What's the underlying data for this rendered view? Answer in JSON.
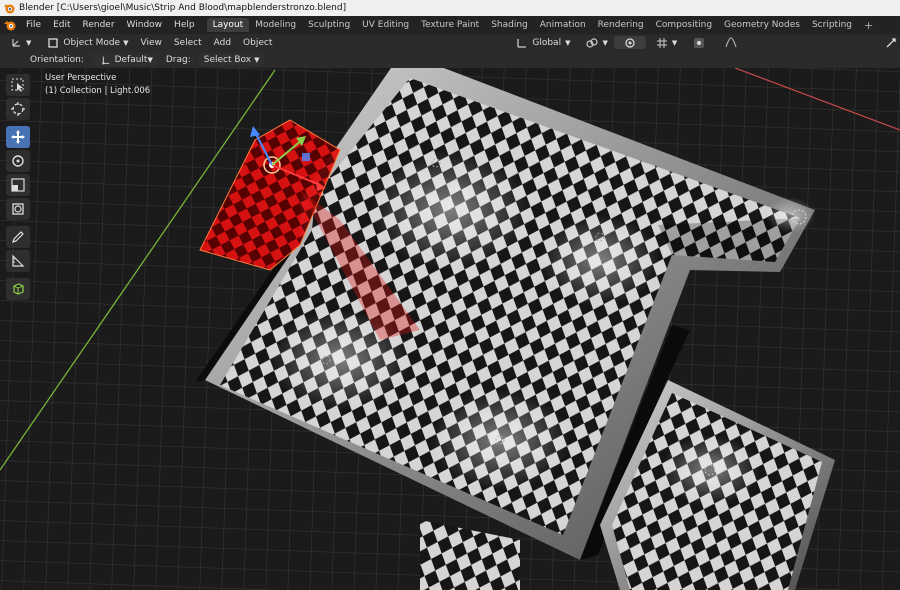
{
  "window": {
    "title": "Blender [C:\\Users\\gioel\\Music\\Strip And Blood\\mapblenderstronzo.blend]"
  },
  "menu": {
    "items": [
      "File",
      "Edit",
      "Render",
      "Window",
      "Help"
    ]
  },
  "workspaces": [
    "Layout",
    "Modeling",
    "Sculpting",
    "UV Editing",
    "Texture Paint",
    "Shading",
    "Animation",
    "Rendering",
    "Compositing",
    "Geometry Nodes",
    "Scripting"
  ],
  "active_workspace": "Layout",
  "viewport_header": {
    "mode": "Object Mode",
    "menus": [
      "View",
      "Select",
      "Add",
      "Object"
    ],
    "transform_orientation": "Global"
  },
  "tool_settings": {
    "orientation_label": "Orientation:",
    "orientation_value": "Default",
    "drag_label": "Drag:",
    "drag_value": "Select Box"
  },
  "viewport": {
    "view_name": "User Perspective",
    "collection_info": "(1) Collection | Light.006"
  },
  "toolbar": [
    "select-box-tool",
    "cursor-tool",
    "move-tool",
    "rotate-tool",
    "scale-tool",
    "transform-tool",
    "annotate-tool",
    "measure-tool",
    "add-cube-tool"
  ],
  "colors": {
    "accent_blue": "#4772b3",
    "x_axis_red": "#c84b4b",
    "y_axis_green": "#79b33a",
    "selected_red": "#e01010"
  }
}
